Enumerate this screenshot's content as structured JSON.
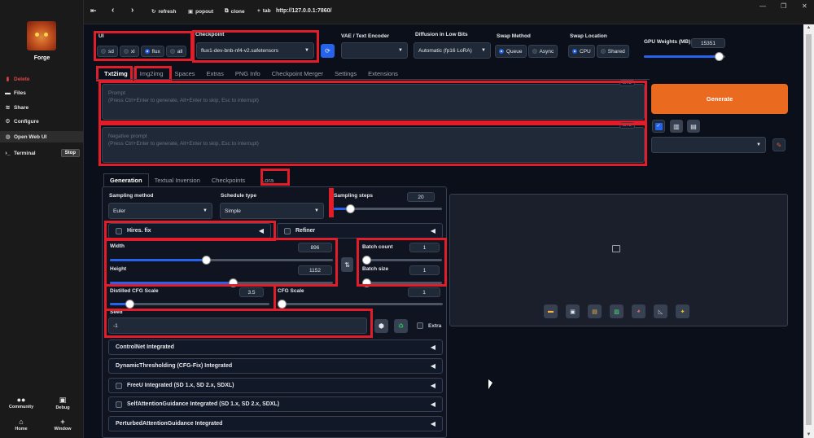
{
  "sidebar": {
    "app_name": "Forge",
    "items": [
      {
        "label": "Delete",
        "icon": "trash-icon",
        "color": "#e04444"
      },
      {
        "label": "Files",
        "icon": "folder-icon"
      },
      {
        "label": "Share",
        "icon": "wifi-icon"
      },
      {
        "label": "Configure",
        "icon": "gear-icon"
      },
      {
        "label": "Open Web UI",
        "icon": "globe-icon"
      },
      {
        "label": "Terminal",
        "icon": "terminal-icon"
      }
    ],
    "stop_label": "Stop",
    "bottom": [
      {
        "label": "Community",
        "icon": "community-icon"
      },
      {
        "label": "Debug",
        "icon": "debug-icon"
      },
      {
        "label": "Home",
        "icon": "home-icon"
      },
      {
        "label": "Window",
        "icon": "plus-icon"
      }
    ]
  },
  "topbar": {
    "refresh": "refresh",
    "popout": "popout",
    "clone": "clone",
    "tab": "tab",
    "url": "http://127.0.0.1:7860/"
  },
  "ui_selector": {
    "label": "UI",
    "options": [
      "sd",
      "xl",
      "flux",
      "all"
    ],
    "selected": "flux"
  },
  "checkpoint": {
    "label": "Checkpoint",
    "value": "flux1-dev-bnb-nf4-v2.safetensors"
  },
  "vae": {
    "label": "VAE / Text Encoder",
    "value": ""
  },
  "diffusion": {
    "label": "Diffusion in Low Bits",
    "value": "Automatic (fp16 LoRA)"
  },
  "swap_method": {
    "label": "Swap Method",
    "options": [
      "Queue",
      "Async"
    ],
    "selected": "Queue"
  },
  "swap_location": {
    "label": "Swap Location",
    "options": [
      "CPU",
      "Shared"
    ],
    "selected": "CPU"
  },
  "gpu_weights": {
    "label": "GPU Weights (MB)",
    "value": "15351",
    "fraction": 0.92
  },
  "main_tabs": [
    "Txt2img",
    "Img2img",
    "Spaces",
    "Extras",
    "PNG Info",
    "Checkpoint Merger",
    "Settings",
    "Extensions"
  ],
  "prompt": {
    "label": "Prompt",
    "placeholder": "(Press Ctrl+Enter to generate, Alt+Enter to skip, Esc to interrupt)",
    "counter": "0/75"
  },
  "negative_prompt": {
    "label": "Negative prompt",
    "placeholder": "(Press Ctrl+Enter to generate, Alt+Enter to skip, Esc to interrupt)",
    "counter": "0/75"
  },
  "generate_label": "Generate",
  "sub_tabs": [
    "Generation",
    "Textual Inversion",
    "Checkpoints",
    "Lora"
  ],
  "sampling_method": {
    "label": "Sampling method",
    "value": "Euler"
  },
  "schedule_type": {
    "label": "Schedule type",
    "value": "Simple"
  },
  "sampling_steps": {
    "label": "Sampling steps",
    "value": "20",
    "fraction": 0.15
  },
  "hires_fix": {
    "label": "Hires. fix"
  },
  "refiner": {
    "label": "Refiner"
  },
  "width": {
    "label": "Width",
    "value": "896",
    "fraction": 0.43
  },
  "height": {
    "label": "Height",
    "value": "1152",
    "fraction": 0.55
  },
  "batch_count": {
    "label": "Batch count",
    "value": "1",
    "fraction": 0.0
  },
  "batch_size": {
    "label": "Batch size",
    "value": "1",
    "fraction": 0.0
  },
  "distilled_cfg": {
    "label": "Distilled CFG Scale",
    "value": "3.5",
    "fraction": 0.12
  },
  "cfg_scale": {
    "label": "CFG Scale",
    "value": "1",
    "fraction": 0.0
  },
  "seed": {
    "label": "Seed",
    "value": "-1",
    "extra_label": "Extra"
  },
  "accordions": [
    "ControlNet Integrated",
    "DynamicThresholding (CFG-Fix) Integrated",
    "FreeU Integrated (SD 1.x, SD 2.x, SDXL)",
    "SelfAttentionGuidance Integrated (SD 1.x, SD 2.x, SDXL)",
    "PerturbedAttentionGuidance Integrated"
  ],
  "colors": {
    "accent": "#2563eb",
    "generate": "#ea6a20",
    "highlight": "#e11d2a"
  }
}
